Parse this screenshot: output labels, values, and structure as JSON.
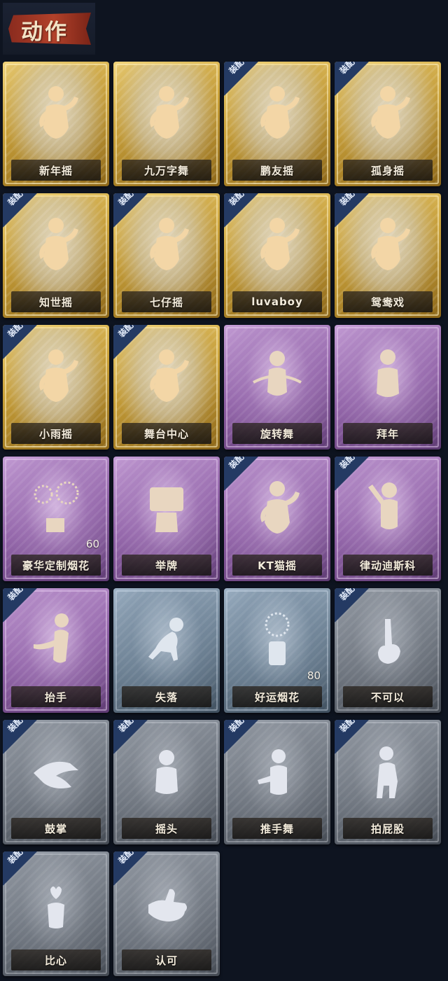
{
  "header": {
    "title": "动作"
  },
  "badge_text": "装配",
  "actions": [
    {
      "label": "新年摇",
      "tier": "gold",
      "equipped": false,
      "icon": "dance-figure-icon"
    },
    {
      "label": "九万字舞",
      "tier": "gold",
      "equipped": false,
      "icon": "dance-figure-icon"
    },
    {
      "label": "鹏友摇",
      "tier": "gold",
      "equipped": true,
      "icon": "dance-figure-icon"
    },
    {
      "label": "孤身摇",
      "tier": "gold",
      "equipped": true,
      "icon": "dance-figure-icon"
    },
    {
      "label": "知世摇",
      "tier": "gold",
      "equipped": true,
      "icon": "dance-figure-icon"
    },
    {
      "label": "七仔摇",
      "tier": "gold",
      "equipped": true,
      "icon": "dance-figure-icon"
    },
    {
      "label": "luvaboy",
      "tier": "gold",
      "equipped": true,
      "icon": "dance-figure-icon"
    },
    {
      "label": "鸳鸯戏",
      "tier": "gold",
      "equipped": true,
      "icon": "dance-figure-icon"
    },
    {
      "label": "小雨摇",
      "tier": "gold",
      "equipped": true,
      "icon": "dance-figure-icon"
    },
    {
      "label": "舞台中心",
      "tier": "gold",
      "equipped": true,
      "icon": "dance-figure-icon"
    },
    {
      "label": "旋转舞",
      "tier": "purple",
      "equipped": false,
      "icon": "spin-figure-icon"
    },
    {
      "label": "拜年",
      "tier": "purple",
      "equipped": false,
      "icon": "greeting-figure-icon"
    },
    {
      "label": "豪华定制烟花",
      "tier": "purple",
      "equipped": false,
      "icon": "fireworks-box-icon",
      "count": "60"
    },
    {
      "label": "举牌",
      "tier": "purple",
      "equipped": false,
      "icon": "sign-holding-figure-icon"
    },
    {
      "label": "KT猫摇",
      "tier": "purple",
      "equipped": true,
      "icon": "dance-figure-icon"
    },
    {
      "label": "律动迪斯科",
      "tier": "purple",
      "equipped": true,
      "icon": "disco-figure-icon"
    },
    {
      "label": "抬手",
      "tier": "purple",
      "equipped": true,
      "icon": "raise-hand-figure-icon"
    },
    {
      "label": "失落",
      "tier": "blue",
      "equipped": false,
      "icon": "crawling-figure-icon"
    },
    {
      "label": "好运烟花",
      "tier": "blue",
      "equipped": false,
      "icon": "firework-can-icon",
      "count": "80"
    },
    {
      "label": "不可以",
      "tier": "gray",
      "equipped": true,
      "icon": "finger-wag-icon"
    },
    {
      "label": "鼓掌",
      "tier": "gray",
      "equipped": true,
      "icon": "clapping-hands-icon"
    },
    {
      "label": "摇头",
      "tier": "gray",
      "equipped": true,
      "icon": "head-shake-figure-icon"
    },
    {
      "label": "推手舞",
      "tier": "gray",
      "equipped": true,
      "icon": "push-hands-figure-icon"
    },
    {
      "label": "拍屁股",
      "tier": "gray",
      "equipped": true,
      "icon": "bum-slap-figure-icon"
    },
    {
      "label": "比心",
      "tier": "gray",
      "equipped": true,
      "icon": "finger-heart-icon"
    },
    {
      "label": "认可",
      "tier": "gray",
      "equipped": true,
      "icon": "thumbs-up-icon"
    }
  ],
  "colors": {
    "background": "#0e1420",
    "gold": "#c9a037",
    "purple": "#8d5ea4",
    "blue": "#6d8193",
    "gray": "#6e757f",
    "badge": "#243a63",
    "title_ribbon": "#b2412a"
  }
}
